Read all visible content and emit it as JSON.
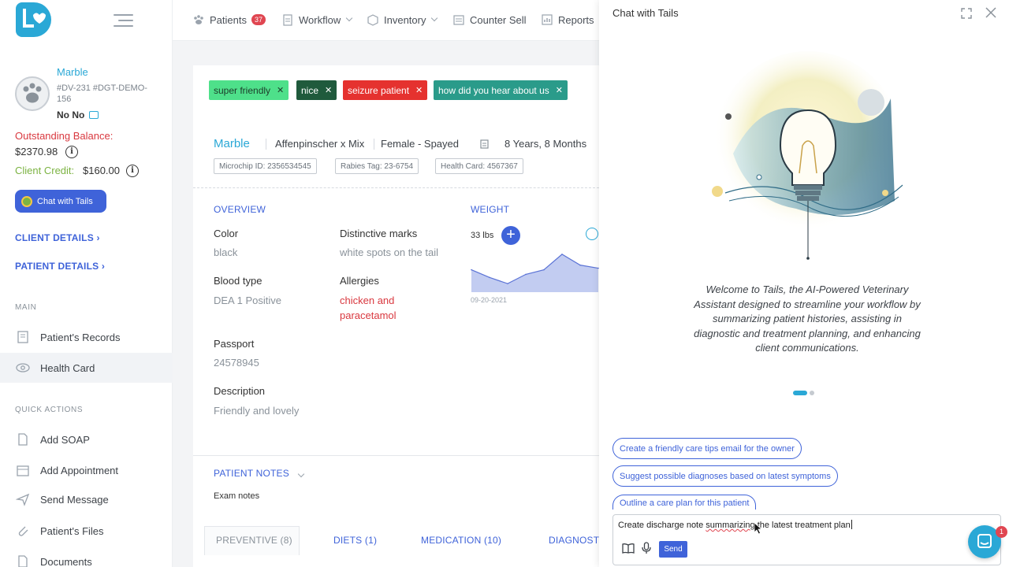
{
  "sidebar": {
    "patient": {
      "name": "Marble",
      "ids": "#DV-231 #DGT-DEMO-156",
      "owner": "No No"
    },
    "balance": {
      "label": "Outstanding Balance:",
      "value": "$2370.98"
    },
    "credit": {
      "label": "Client Credit:",
      "value": "$160.00"
    },
    "chat_button": "Chat with Tails",
    "client_details": "CLIENT DETAILS",
    "patient_details": "PATIENT DETAILS",
    "main_heading": "MAIN",
    "main_items": [
      "Patient's Records",
      "Health Card"
    ],
    "quick_heading": "QUICK ACTIONS",
    "quick_items": [
      "Add SOAP",
      "Add Appointment",
      "Send Message",
      "Patient's Files",
      "Documents"
    ]
  },
  "topnav": {
    "patients": "Patients",
    "patients_count": "37",
    "workflow": "Workflow",
    "inventory": "Inventory",
    "counter_sell": "Counter Sell",
    "reports": "Reports"
  },
  "tags": [
    {
      "label": "super friendly",
      "color": "#4ee08a",
      "text_color": "#1d3b2a"
    },
    {
      "label": "nice",
      "color": "#1f5a3c",
      "text_color": "#ffffff"
    },
    {
      "label": "seizure patient",
      "color": "#e5322f",
      "text_color": "#ffffff"
    },
    {
      "label": "how did you hear about us",
      "color": "#2a9b8a",
      "text_color": "#ffffff"
    }
  ],
  "patient": {
    "name": "Marble",
    "breed": "Affenpinscher x Mix",
    "sex": "Female - Spayed",
    "age": "8 Years, 8 Months",
    "microchip": "Microchip ID: 2356534545",
    "rabies": "Rabies Tag: 23-6754",
    "health_card": "Health Card: 4567367"
  },
  "overview": {
    "heading": "OVERVIEW",
    "color_label": "Color",
    "color_value": "black",
    "marks_label": "Distinctive marks",
    "marks_value": "white spots on the tail",
    "blood_label": "Blood type",
    "blood_value": "DEA 1 Positive",
    "allergies_label": "Allergies",
    "allergies_value": "chicken and paracetamol",
    "passport_label": "Passport",
    "passport_value": "24578945",
    "desc_label": "Description",
    "desc_value": "Friendly and lovely"
  },
  "weight": {
    "heading": "WEIGHT",
    "current": "33 lbs",
    "first_date": "09-20-2021"
  },
  "chart_data": {
    "type": "area",
    "x": [
      "09-20-2021",
      "",
      "",
      "",
      "",
      "",
      "",
      ""
    ],
    "values": [
      28,
      23,
      19,
      25,
      28,
      38,
      31,
      29
    ],
    "title": "",
    "xlabel": "",
    "ylabel": "",
    "color": "#8fa3e6"
  },
  "notes": {
    "heading": "PATIENT NOTES",
    "sub": "Exam notes"
  },
  "tabs": [
    "PREVENTIVE  (8)",
    "DIETS  (1)",
    "MEDICATION  (10)",
    "DIAGNOST"
  ],
  "chat": {
    "title": "Chat with Tails",
    "welcome": "Welcome to Tails, the AI-Powered Veterinary Assistant designed to streamline your workflow by summarizing patient histories, assisting in diagnostic and treatment planning, and enhancing client communications.",
    "suggestions": [
      "Create a friendly care tips email for the owner",
      "Suggest possible diagnoses based on latest symptoms",
      "Outline a care plan for this patient"
    ],
    "input_before": "Create discharge note ",
    "input_misspelled": "summarizing",
    "input_after": " the latest treatment plan",
    "send": "Send"
  },
  "fab_badge": "1"
}
